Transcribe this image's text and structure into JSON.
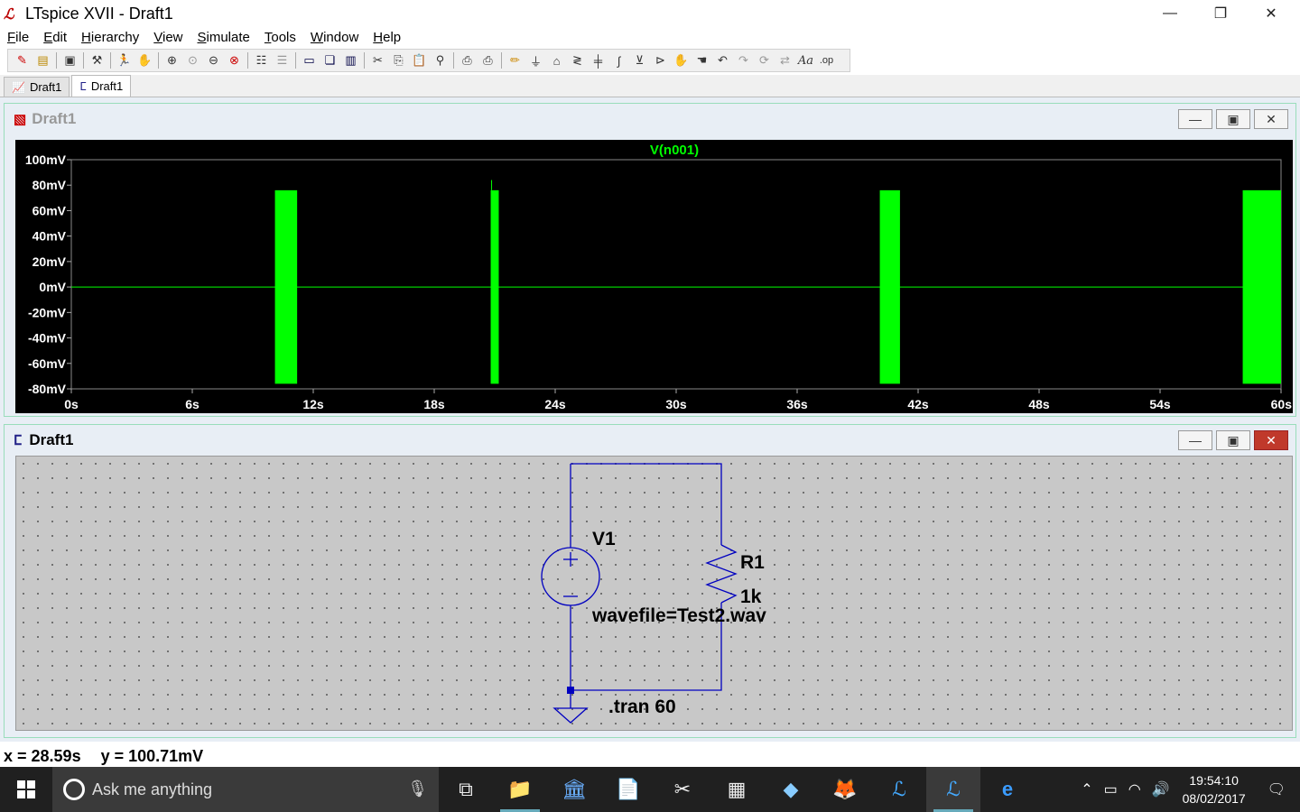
{
  "window": {
    "title": "LTspice XVII - Draft1"
  },
  "menu": [
    "File",
    "Edit",
    "Hierarchy",
    "View",
    "Simulate",
    "Tools",
    "Window",
    "Help"
  ],
  "toolbar_icons": [
    "new-schematic",
    "open",
    "save",
    "control-panel",
    "run",
    "halt",
    "zoom-in",
    "zoom-pan",
    "zoom-out",
    "zoom-full",
    "autorange",
    "mark-unref",
    "tile",
    "cascade",
    "tile-vertical",
    "cut",
    "copy",
    "paste",
    "find",
    "print-setup",
    "print",
    "wire",
    "ground",
    "label-net",
    "resistor",
    "capacitor",
    "inductor",
    "diode",
    "component",
    "move",
    "drag",
    "undo",
    "redo",
    "rotate",
    "mirror",
    "text",
    "spice-directive"
  ],
  "tabs": [
    {
      "label": "Draft1",
      "icon": "waveform-icon",
      "active": false
    },
    {
      "label": "Draft1",
      "icon": "schematic-icon",
      "active": true
    }
  ],
  "plot_window": {
    "title": "Draft1",
    "trace_label": "V(n001)",
    "trace_color": "#00ff00"
  },
  "chart_data": {
    "type": "line",
    "title": "V(n001)",
    "xlabel": "",
    "ylabel": "",
    "x_ticks": [
      "0s",
      "6s",
      "12s",
      "18s",
      "24s",
      "30s",
      "36s",
      "42s",
      "48s",
      "54s",
      "60s"
    ],
    "y_ticks": [
      "100mV",
      "80mV",
      "60mV",
      "40mV",
      "20mV",
      "0mV",
      "-20mV",
      "-40mV",
      "-60mV",
      "-80mV"
    ],
    "xlim": [
      0,
      60
    ],
    "ylim": [
      -80,
      100
    ],
    "grid": false,
    "series": [
      {
        "name": "V(n001)",
        "baseline": 0,
        "bursts": [
          {
            "start": 10.1,
            "end": 11.2,
            "min": -76,
            "max": 76
          },
          {
            "start": 20.8,
            "end": 21.2,
            "min": -76,
            "max": 84
          },
          {
            "start": 40.1,
            "end": 41.1,
            "min": -76,
            "max": 76
          },
          {
            "start": 58.1,
            "end": 60,
            "min": -76,
            "max": 76
          }
        ]
      }
    ]
  },
  "schematic_window": {
    "title": "Draft1",
    "v1_name": "V1",
    "v1_value": "wavefile=Test2.wav",
    "r1_name": "R1",
    "r1_value": "1k",
    "directive": ".tran 60"
  },
  "status": {
    "x": "x = 28.59s",
    "y": "y = 100.71mV"
  },
  "taskbar": {
    "search_placeholder": "Ask me anything",
    "time": "19:54:10",
    "date": "08/02/2017"
  }
}
